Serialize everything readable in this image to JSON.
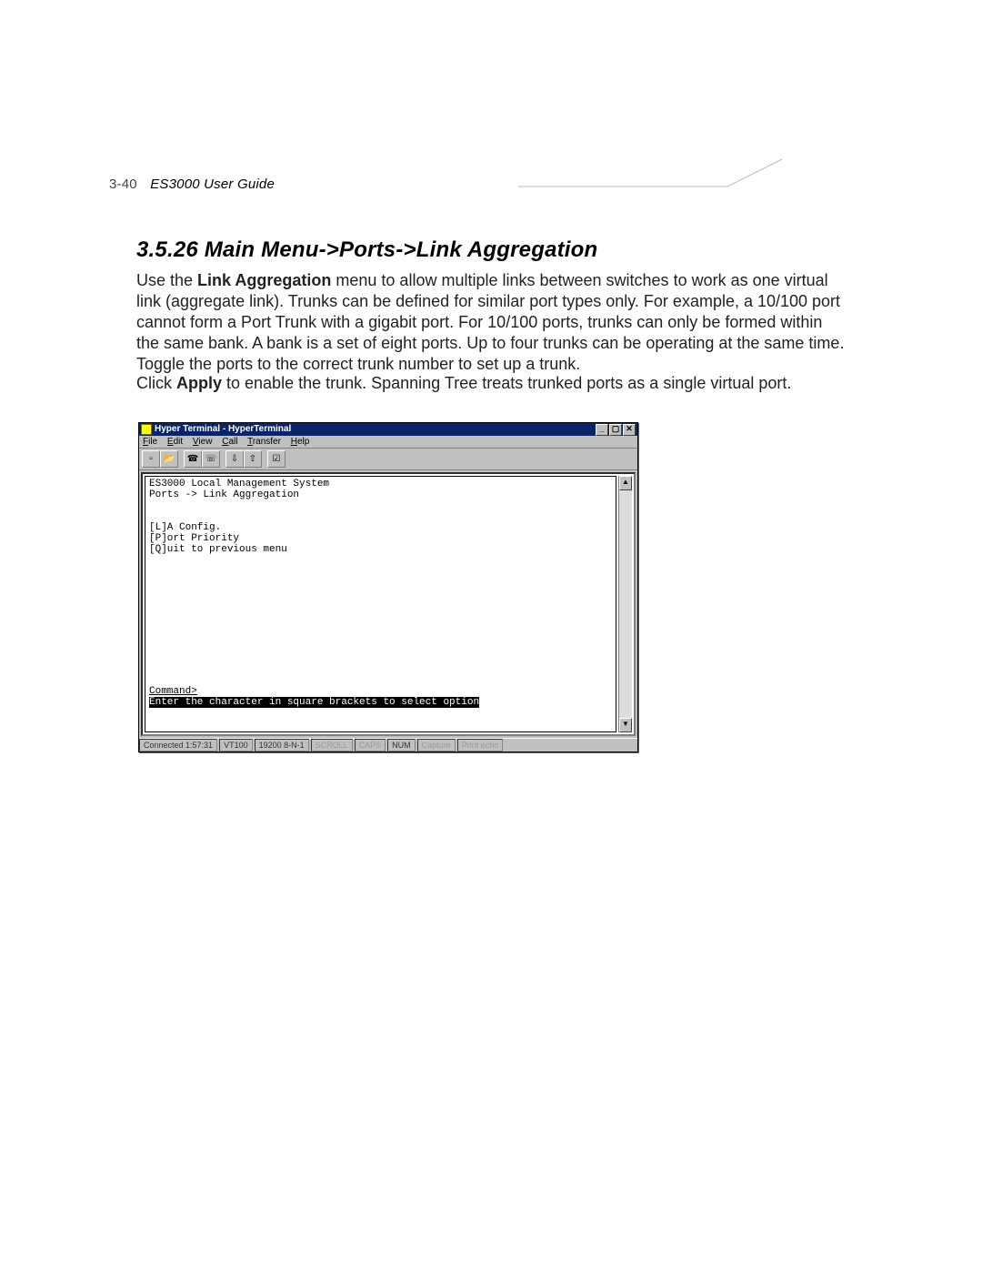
{
  "header": {
    "page_number": "3-40",
    "doc_title": "ES3000 User Guide"
  },
  "section": {
    "heading": "3.5.26  Main Menu->Ports->Link Aggregation"
  },
  "paragraphs": {
    "p1_pre": "Use the ",
    "p1_bold": "Link Aggregation",
    "p1_post": " menu to allow multiple links between switches to work as one virtual link (aggregate link). Trunks can be defined for similar port types only. For example, a 10/100 port cannot form a Port Trunk with a gigabit port. For 10/100 ports, trunks can only be formed within the same bank. A bank is a set of eight ports. Up to four trunks can be operating at the same time. Toggle the ports to the correct trunk number to set up a trunk.",
    "p2_pre": "Click ",
    "p2_bold": "Apply",
    "p2_post": " to enable the trunk. Spanning Tree treats trunked ports as a single virtual port."
  },
  "ht": {
    "title": "Hyper Terminal - HyperTerminal",
    "controls": {
      "min": "_",
      "max": "▢",
      "close": "✕"
    },
    "menu": {
      "file": "File",
      "edit": "Edit",
      "view": "View",
      "call": "Call",
      "transfer": "Transfer",
      "help": "Help"
    },
    "toolbar_icons": [
      "new-doc-icon",
      "open-doc-icon",
      "connect-icon",
      "disconnect-icon",
      "send-icon",
      "receive-icon",
      "properties-icon"
    ],
    "terminal": {
      "line1": "ES3000 Local Management System",
      "line2": "Ports -> Link Aggregation",
      "line3": "",
      "line4": "",
      "line5": "[L]A Config.",
      "line6": "[P]ort Priority",
      "line7": "[Q]uit to previous menu",
      "blank": "",
      "command_label": "Command>",
      "hint": "Enter the character in square brackets to select option"
    },
    "status": {
      "connected": "Connected 1:57:31",
      "emulation": "VT100",
      "settings": "19200 8-N-1",
      "scroll": "SCROLL",
      "caps": "CAPS",
      "num": "NUM",
      "capture": "Capture",
      "printecho": "Print echo"
    }
  }
}
